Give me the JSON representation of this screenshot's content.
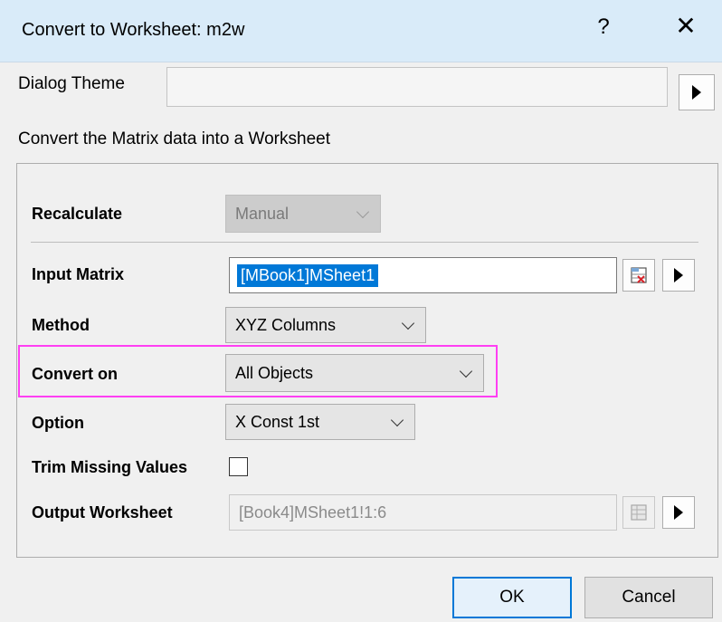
{
  "window": {
    "title": "Convert to Worksheet: m2w",
    "help_glyph": "?",
    "close_glyph": "✕"
  },
  "theme": {
    "label": "Dialog Theme",
    "value": ""
  },
  "description": "Convert the Matrix data into a Worksheet",
  "form": {
    "recalculate": {
      "label": "Recalculate",
      "value": "Manual",
      "enabled": false
    },
    "input_matrix": {
      "label": "Input Matrix",
      "value": "[MBook1]MSheet1"
    },
    "method": {
      "label": "Method",
      "value": "XYZ Columns"
    },
    "convert_on": {
      "label": "Convert on",
      "value": "All Objects"
    },
    "option": {
      "label": "Option",
      "value": "X Const 1st"
    },
    "trim_missing": {
      "label": "Trim Missing Values",
      "checked": false
    },
    "output_worksheet": {
      "label": "Output Worksheet",
      "value": "[Book4]MSheet1!1:6",
      "enabled": false
    }
  },
  "buttons": {
    "ok": "OK",
    "cancel": "Cancel"
  },
  "colors": {
    "titlebar": "#d9ebf9",
    "highlight": "#ff3ff3",
    "selection": "#0078d7"
  },
  "icons": [
    "help-icon",
    "close-icon",
    "arrow-right-icon",
    "select-range-icon",
    "worksheet-icon",
    "chevron-down-icon"
  ]
}
